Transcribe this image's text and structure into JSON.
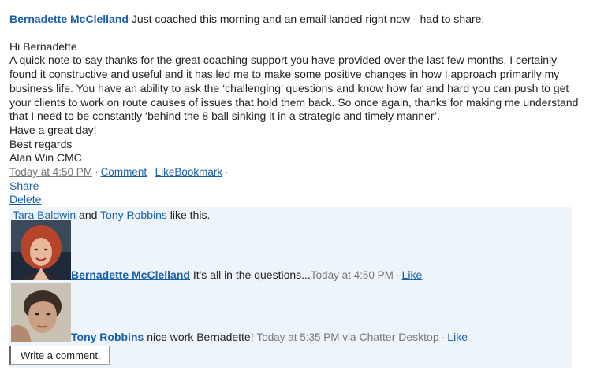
{
  "post": {
    "author": "Bernadette McClelland",
    "intro": "Just coached this morning and an email landed right now - had to share:",
    "lines": [
      "Hi Bernadette",
      "A quick note to say thanks for the great coaching support you have provided over the last few months. I certainly found it constructive and useful and it has led me to make some positive changes in how I approach primarily my business life. You have an ability to ask the ‘challenging’ questions and know how far and hard you can push to get your clients to work on route causes of issues that hold them back. So once again, thanks for making me understand that I need to be constantly ‘behind the 8 ball sinking it in a strategic and timely manner’.",
      "Have a great day!",
      "Best regards",
      "Alan Win CMC"
    ],
    "timestamp": "Today at 4:50 PM",
    "comment_label": "Comment",
    "like_bookmark_label": "LikeBookmark",
    "share_label": "Share",
    "delete_label": "Delete"
  },
  "likes": {
    "person1": "Tara Baldwin",
    "conjunction": "and",
    "person2": "Tony Robbins",
    "suffix": "like this."
  },
  "comments": [
    {
      "author": "Bernadette McClelland",
      "text": "It's all in the questions...",
      "time": "Today at 4:50 PM",
      "like_label": "Like"
    },
    {
      "author": "Tony Robbins",
      "text": "nice work Bernadette!",
      "time": "Today at 5:35 PM via",
      "via": "Chatter Desktop",
      "like_label": "Like"
    }
  ],
  "write_comment": {
    "placeholder": "Write a comment."
  }
}
